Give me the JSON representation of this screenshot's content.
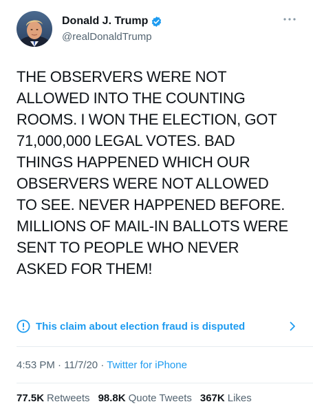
{
  "author": {
    "display_name": "Donald J. Trump",
    "handle": "@realDonaldTrump",
    "verified": true,
    "avatar_icon": "profile-photo"
  },
  "more_icon": "more-options-icon",
  "tweet": {
    "text": "THE OBSERVERS WERE NOT\nALLOWED INTO THE COUNTING\nROOMS. I WON THE ELECTION, GOT\n71,000,000 LEGAL VOTES. BAD\nTHINGS HAPPENED WHICH OUR\nOBSERVERS WERE NOT ALLOWED\nTO SEE. NEVER HAPPENED BEFORE.\nMILLIONS OF MAIL-IN BALLOTS WERE\nSENT TO PEOPLE WHO NEVER\nASKED FOR THEM!"
  },
  "notice": {
    "label": "This claim about election fraud is disputed",
    "icon": "info-icon",
    "chevron": "chevron-right-icon"
  },
  "meta": {
    "time": "4:53 PM",
    "separator": "·",
    "date": "11/7/20",
    "source": "Twitter for iPhone"
  },
  "stats": {
    "retweets_value": "77.5K",
    "retweets_label": "Retweets",
    "quotes_value": "98.8K",
    "quotes_label": "Quote Tweets",
    "likes_value": "367K",
    "likes_label": "Likes"
  },
  "colors": {
    "accent": "#1d9bf0",
    "text": "#0f1419",
    "secondary": "#536471",
    "divider": "#e6ecf0"
  }
}
